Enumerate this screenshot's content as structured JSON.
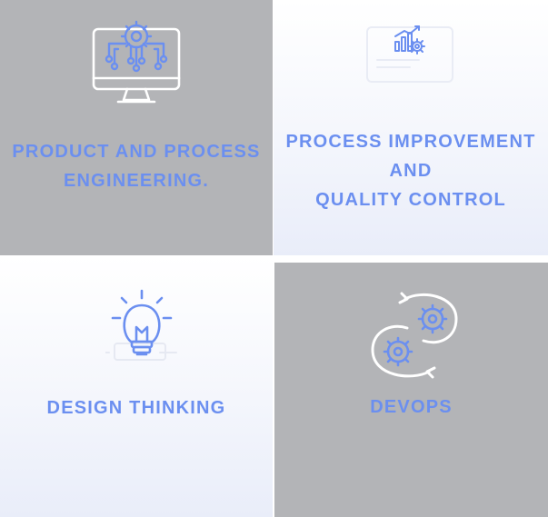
{
  "colors": {
    "accent": "#6b8ff0",
    "tile_gray": "#b3b4b7",
    "tile_light": "#f4f6fc",
    "icon_white": "#ffffff"
  },
  "tiles": [
    {
      "icon": "monitor-gear-circuit-icon",
      "title_lines": [
        "PRODUCT AND PROCESS",
        "ENGINEERING."
      ]
    },
    {
      "icon": "chart-gear-monitor-icon",
      "title_lines": [
        "PROCESS IMPROVEMENT",
        "AND",
        "QUALITY CONTROL"
      ]
    },
    {
      "icon": "lightbulb-icon",
      "title_lines": [
        "DESIGN THINKING"
      ]
    },
    {
      "icon": "cycle-gears-icon",
      "title_lines": [
        "DEVOPS"
      ]
    }
  ]
}
